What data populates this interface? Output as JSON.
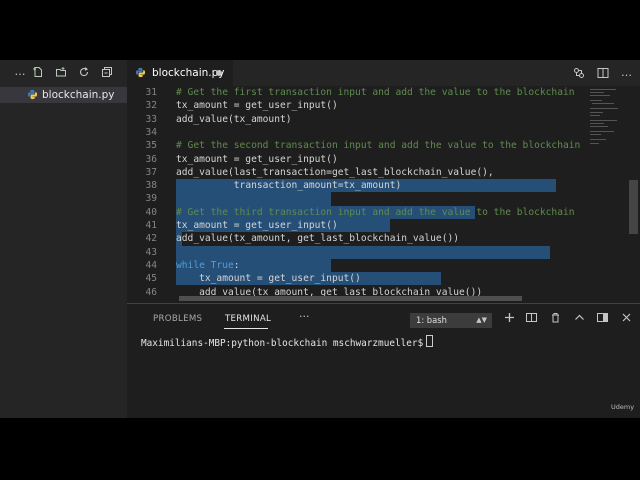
{
  "explorer": {
    "toolbar_icons": [
      "more-icon",
      "new-file-icon",
      "new-folder-icon",
      "refresh-icon",
      "collapse-all-icon"
    ],
    "files": [
      {
        "name": "blockchain.py",
        "icon": "python-icon"
      }
    ]
  },
  "tab": {
    "filename": "blockchain.py",
    "modified": true,
    "actions": [
      "open-changes-icon",
      "split-editor-icon",
      "more-actions-icon"
    ]
  },
  "editor": {
    "lines": [
      {
        "num": "31",
        "indent": "",
        "text": "# Get the first transaction input and add the value to the blockchain",
        "kind": "comment"
      },
      {
        "num": "32",
        "indent": "",
        "text": "tx_amount = get_user_input()",
        "kind": "text"
      },
      {
        "num": "33",
        "indent": "",
        "text": "add_value(tx_amount)",
        "kind": "text"
      },
      {
        "num": "34",
        "indent": "",
        "text": "",
        "kind": "text"
      },
      {
        "num": "35",
        "indent": "",
        "text": "# Get the second transaction input and add the value to the blockchain",
        "kind": "comment"
      },
      {
        "num": "36",
        "indent": "",
        "text": "tx_amount = get_user_input()",
        "kind": "text"
      },
      {
        "num": "37",
        "indent": "",
        "text": "add_value(last_transaction=get_last_blockchain_value(),",
        "kind": "text"
      },
      {
        "num": "38",
        "indent": "          ",
        "text": "transaction_amount=tx_amount)",
        "kind": "text"
      },
      {
        "num": "39",
        "indent": "",
        "text": "",
        "kind": "text"
      },
      {
        "num": "40",
        "indent": "",
        "text": "# Get the third transaction input and add the value to the blockchain",
        "kind": "comment"
      },
      {
        "num": "41",
        "indent": "",
        "text": "tx_amount = get_user_input()",
        "kind": "text"
      },
      {
        "num": "42",
        "indent": "",
        "text": "add_value(tx_amount, get_last_blockchain_value())",
        "kind": "text"
      },
      {
        "num": "43",
        "indent": "",
        "text": "",
        "kind": "text"
      },
      {
        "num": "44",
        "indent": "",
        "text": "",
        "kind": "while",
        "keyword": "while",
        "constant": "True",
        "punct": ":"
      },
      {
        "num": "45",
        "indent": "    ",
        "text": "tx_amount = get_user_input()",
        "kind": "text"
      },
      {
        "num": "46",
        "indent": "    ",
        "text": "add_value(tx_amount, get_last_blockchain_value())",
        "kind": "text"
      }
    ]
  },
  "panel": {
    "tabs": [
      "PROBLEMS",
      "TERMINAL"
    ],
    "active_tab": "TERMINAL",
    "more": "···",
    "terminal_select": "1: bash",
    "actions": [
      "new-terminal-icon",
      "split-terminal-icon",
      "kill-terminal-icon",
      "maximize-panel-icon",
      "toggle-panel-icon",
      "close-panel-icon"
    ],
    "prompt": "Maximilians-MBP:python-blockchain mschwarzmueller$"
  },
  "watermark": "Udemy",
  "colors": {
    "comment": "#608b4e",
    "keyword": "#569cd6",
    "selection": "#264f78",
    "line_number": "#858585",
    "text": "#d4d4d4"
  }
}
